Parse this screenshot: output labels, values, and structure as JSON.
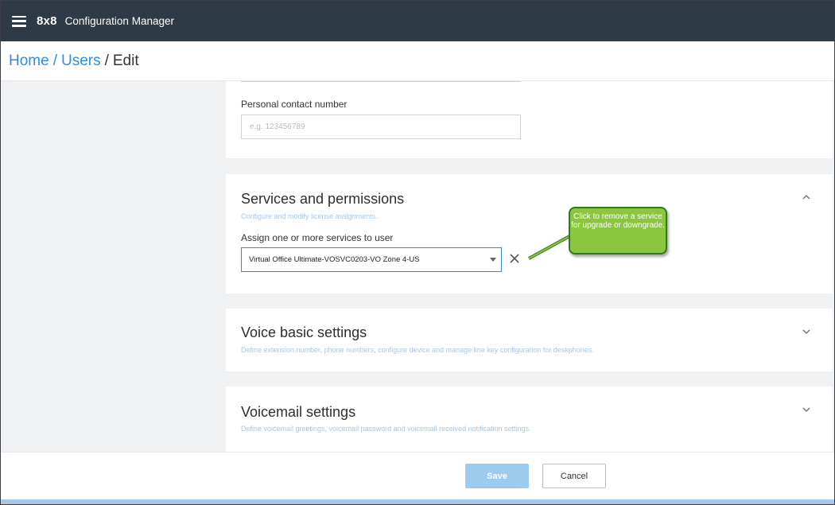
{
  "app": {
    "brand": "8x8",
    "title": "Configuration Manager"
  },
  "breadcrumb": {
    "items": [
      "Home",
      "Users"
    ],
    "separator": "/",
    "current": "Edit"
  },
  "personal_contact": {
    "label": "Personal contact number",
    "placeholder": "e.g. 123456789",
    "value": ""
  },
  "services": {
    "title": "Services and permissions",
    "subtitle": "Configure and modify license assignments.",
    "assign_label": "Assign one or more services to user",
    "selected_service": "Virtual Office Ultimate-VOSVC0203-VO Zone 4-US",
    "expanded": true
  },
  "callout": {
    "text": "Click to remove a service for upgrade or downgrade.",
    "color": "#8cc63f"
  },
  "voice_basic": {
    "title": "Voice basic settings",
    "subtitle": "Define extension number, phone numbers, configure device and manage line key configuration for deskphones.",
    "expanded": false
  },
  "voicemail": {
    "title": "Voicemail settings",
    "subtitle": "Define voicemail greetings, voicemail password and voicemail received notification settings.",
    "expanded": false
  },
  "footer": {
    "save_label": "Save",
    "cancel_label": "Cancel"
  },
  "colors": {
    "topbar": "#2e3a45",
    "link": "#2f8fd6",
    "save_button": "#9ccbee"
  },
  "icons": {
    "menu": "hamburger-icon",
    "collapse": "chevron-up-icon",
    "expand": "chevron-down-icon",
    "remove": "close-icon",
    "dropdown": "caret-down-icon"
  }
}
